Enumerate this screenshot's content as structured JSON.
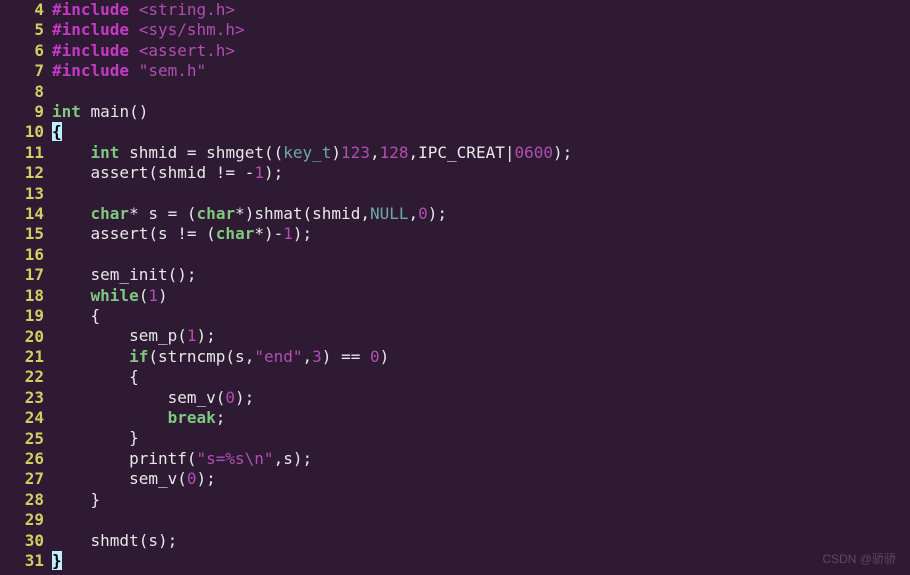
{
  "editor": {
    "first_line_number": 4,
    "lines": [
      {
        "n": 4,
        "tokens": [
          [
            "pp",
            "#include"
          ],
          [
            "plain",
            " "
          ],
          [
            "str",
            "<string.h>"
          ]
        ]
      },
      {
        "n": 5,
        "tokens": [
          [
            "pp",
            "#include"
          ],
          [
            "plain",
            " "
          ],
          [
            "str",
            "<sys/shm.h>"
          ]
        ]
      },
      {
        "n": 6,
        "tokens": [
          [
            "pp",
            "#include"
          ],
          [
            "plain",
            " "
          ],
          [
            "str",
            "<assert.h>"
          ]
        ]
      },
      {
        "n": 7,
        "tokens": [
          [
            "pp",
            "#include"
          ],
          [
            "plain",
            " "
          ],
          [
            "str",
            "\"sem.h\""
          ]
        ]
      },
      {
        "n": 8,
        "tokens": [
          [
            "plain",
            ""
          ]
        ]
      },
      {
        "n": 9,
        "tokens": [
          [
            "kw",
            "int"
          ],
          [
            "plain",
            " "
          ],
          [
            "ident",
            "main"
          ],
          [
            "punct",
            "()"
          ]
        ]
      },
      {
        "n": 10,
        "tokens": [
          [
            "cursor",
            "{"
          ]
        ]
      },
      {
        "n": 11,
        "tokens": [
          [
            "plain",
            "    "
          ],
          [
            "kw",
            "int"
          ],
          [
            "plain",
            " "
          ],
          [
            "ident",
            "shmid"
          ],
          [
            "plain",
            " "
          ],
          [
            "punct",
            "="
          ],
          [
            "plain",
            " "
          ],
          [
            "ident",
            "shmget"
          ],
          [
            "punct",
            "(("
          ],
          [
            "null",
            "key_t"
          ],
          [
            "punct",
            ")"
          ],
          [
            "num",
            "123"
          ],
          [
            "punct",
            ","
          ],
          [
            "num",
            "128"
          ],
          [
            "punct",
            ","
          ],
          [
            "ident",
            "IPC_CREAT"
          ],
          [
            "punct",
            "|"
          ],
          [
            "num",
            "0600"
          ],
          [
            "punct",
            ");"
          ]
        ]
      },
      {
        "n": 12,
        "tokens": [
          [
            "plain",
            "    "
          ],
          [
            "ident",
            "assert"
          ],
          [
            "punct",
            "("
          ],
          [
            "ident",
            "shmid"
          ],
          [
            "plain",
            " "
          ],
          [
            "punct",
            "!="
          ],
          [
            "plain",
            " "
          ],
          [
            "punct",
            "-"
          ],
          [
            "num",
            "1"
          ],
          [
            "punct",
            ");"
          ]
        ]
      },
      {
        "n": 13,
        "tokens": [
          [
            "plain",
            ""
          ]
        ]
      },
      {
        "n": 14,
        "tokens": [
          [
            "plain",
            "    "
          ],
          [
            "kw",
            "char"
          ],
          [
            "punct",
            "*"
          ],
          [
            "plain",
            " "
          ],
          [
            "ident",
            "s"
          ],
          [
            "plain",
            " "
          ],
          [
            "punct",
            "="
          ],
          [
            "plain",
            " "
          ],
          [
            "punct",
            "("
          ],
          [
            "kw",
            "char"
          ],
          [
            "punct",
            "*)"
          ],
          [
            "ident",
            "shmat"
          ],
          [
            "punct",
            "("
          ],
          [
            "ident",
            "shmid"
          ],
          [
            "punct",
            ","
          ],
          [
            "null",
            "NULL"
          ],
          [
            "punct",
            ","
          ],
          [
            "num",
            "0"
          ],
          [
            "punct",
            ");"
          ]
        ]
      },
      {
        "n": 15,
        "tokens": [
          [
            "plain",
            "    "
          ],
          [
            "ident",
            "assert"
          ],
          [
            "punct",
            "("
          ],
          [
            "ident",
            "s"
          ],
          [
            "plain",
            " "
          ],
          [
            "punct",
            "!="
          ],
          [
            "plain",
            " "
          ],
          [
            "punct",
            "("
          ],
          [
            "kw",
            "char"
          ],
          [
            "punct",
            "*)-"
          ],
          [
            "num",
            "1"
          ],
          [
            "punct",
            ");"
          ]
        ]
      },
      {
        "n": 16,
        "tokens": [
          [
            "plain",
            ""
          ]
        ]
      },
      {
        "n": 17,
        "tokens": [
          [
            "plain",
            "    "
          ],
          [
            "ident",
            "sem_init"
          ],
          [
            "punct",
            "();"
          ]
        ]
      },
      {
        "n": 18,
        "tokens": [
          [
            "plain",
            "    "
          ],
          [
            "kw",
            "while"
          ],
          [
            "punct",
            "("
          ],
          [
            "num",
            "1"
          ],
          [
            "punct",
            ")"
          ]
        ]
      },
      {
        "n": 19,
        "tokens": [
          [
            "plain",
            "    "
          ],
          [
            "punct",
            "{"
          ]
        ]
      },
      {
        "n": 20,
        "tokens": [
          [
            "plain",
            "        "
          ],
          [
            "ident",
            "sem_p"
          ],
          [
            "punct",
            "("
          ],
          [
            "num",
            "1"
          ],
          [
            "punct",
            ");"
          ]
        ]
      },
      {
        "n": 21,
        "tokens": [
          [
            "plain",
            "        "
          ],
          [
            "kw",
            "if"
          ],
          [
            "punct",
            "("
          ],
          [
            "ident",
            "strncmp"
          ],
          [
            "punct",
            "("
          ],
          [
            "ident",
            "s"
          ],
          [
            "punct",
            ","
          ],
          [
            "str",
            "\"end\""
          ],
          [
            "punct",
            ","
          ],
          [
            "num",
            "3"
          ],
          [
            "punct",
            ")"
          ],
          [
            "plain",
            " "
          ],
          [
            "punct",
            "=="
          ],
          [
            "plain",
            " "
          ],
          [
            "num",
            "0"
          ],
          [
            "punct",
            ")"
          ]
        ]
      },
      {
        "n": 22,
        "tokens": [
          [
            "plain",
            "        "
          ],
          [
            "punct",
            "{"
          ]
        ]
      },
      {
        "n": 23,
        "tokens": [
          [
            "plain",
            "            "
          ],
          [
            "ident",
            "sem_v"
          ],
          [
            "punct",
            "("
          ],
          [
            "num",
            "0"
          ],
          [
            "punct",
            ");"
          ]
        ]
      },
      {
        "n": 24,
        "tokens": [
          [
            "plain",
            "            "
          ],
          [
            "kw",
            "break"
          ],
          [
            "punct",
            ";"
          ]
        ]
      },
      {
        "n": 25,
        "tokens": [
          [
            "plain",
            "        "
          ],
          [
            "punct",
            "}"
          ]
        ]
      },
      {
        "n": 26,
        "tokens": [
          [
            "plain",
            "        "
          ],
          [
            "ident",
            "printf"
          ],
          [
            "punct",
            "("
          ],
          [
            "str",
            "\"s=%s\\n\""
          ],
          [
            "punct",
            ","
          ],
          [
            "ident",
            "s"
          ],
          [
            "punct",
            ");"
          ]
        ]
      },
      {
        "n": 27,
        "tokens": [
          [
            "plain",
            "        "
          ],
          [
            "ident",
            "sem_v"
          ],
          [
            "punct",
            "("
          ],
          [
            "num",
            "0"
          ],
          [
            "punct",
            ");"
          ]
        ]
      },
      {
        "n": 28,
        "tokens": [
          [
            "plain",
            "    "
          ],
          [
            "punct",
            "}"
          ]
        ]
      },
      {
        "n": 29,
        "tokens": [
          [
            "plain",
            ""
          ]
        ]
      },
      {
        "n": 30,
        "tokens": [
          [
            "plain",
            "    "
          ],
          [
            "ident",
            "shmdt"
          ],
          [
            "punct",
            "("
          ],
          [
            "ident",
            "s"
          ],
          [
            "punct",
            ");"
          ]
        ]
      },
      {
        "n": 31,
        "tokens": [
          [
            "cursor",
            "}"
          ]
        ]
      }
    ]
  },
  "watermark": {
    "line1": "",
    "line2": "CSDN @骄骄"
  }
}
